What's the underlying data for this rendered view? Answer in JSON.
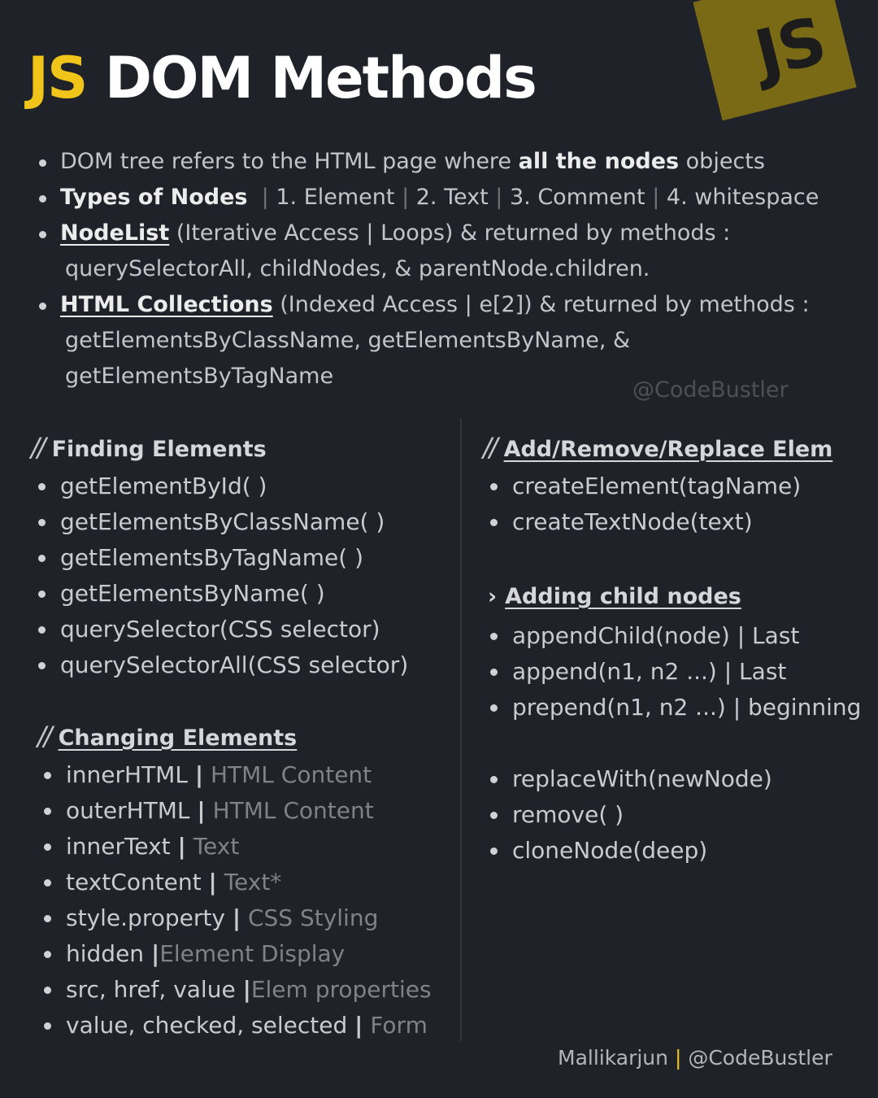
{
  "logo": {
    "text": "JS"
  },
  "title": {
    "js": "JS",
    "rest": "DOM Methods"
  },
  "intro": {
    "b1": {
      "pre": "DOM tree refers to the HTML page where ",
      "bold": "all the nodes",
      "post": " objects"
    },
    "b2": {
      "bold": "Types of Nodes",
      "s1": "|",
      "p1": " 1. Element ",
      "s2": "|",
      "p2": " 2. Text ",
      "s3": "|",
      "p3": " 3. Comment ",
      "s4": "|",
      "p4": " 4. whitespace"
    },
    "b3": {
      "bold": "NodeList",
      "post": " (Iterative Access | Loops) & returned by methods :",
      "cont": "querySelectorAll, childNodes, & parentNode.children."
    },
    "b4": {
      "bold": "HTML Collections",
      "post": " (Indexed  Access | e[2]) & returned by methods :",
      "cont1": "getElementsByClassName, getElementsByName, &",
      "cont2": "getElementsByTagName"
    }
  },
  "watermark": "@CodeBustler",
  "finding": {
    "slashes": "//",
    "title": "Finding Elements",
    "items": [
      "getElementById( )",
      "getElementsByClassName( )",
      "getElementsByTagName( )",
      "getElementsByName( )",
      "querySelector(CSS selector)",
      "querySelectorAll(CSS selector)"
    ]
  },
  "changing": {
    "slashes": "//",
    "title": "Changing Elements",
    "bar": "|",
    "items": [
      {
        "name": "innerHTML",
        "desc": " HTML Content"
      },
      {
        "name": "outerHTML",
        "desc": "HTML Content"
      },
      {
        "name": "innerText",
        "desc": "Text"
      },
      {
        "name": "textContent",
        "desc": "Text*"
      },
      {
        "name": "style.property",
        "desc": "CSS Styling"
      },
      {
        "name": "hidden",
        "desc": "Element Display"
      },
      {
        "name": "src, href, value",
        "desc": "Elem properties"
      },
      {
        "name": "value, checked, selected",
        "desc": "Form"
      }
    ]
  },
  "addremove": {
    "slashes": "//",
    "title": "Add/Remove/Replace Elem",
    "items": [
      "createElement(tagName)",
      "createTextNode(text)"
    ]
  },
  "adding": {
    "marker": "›",
    "title": "Adding child nodes",
    "items": [
      "appendChild(node) | Last",
      "append(n1, n2 ...) | Last",
      "prepend(n1, n2 ...) | beginning"
    ]
  },
  "other": {
    "items": [
      "replaceWith(newNode)",
      "remove( )",
      "cloneNode(deep)"
    ]
  },
  "footer": {
    "name": "Mallikarjun ",
    "pipe": "|",
    "handle": " @CodeBustler"
  }
}
